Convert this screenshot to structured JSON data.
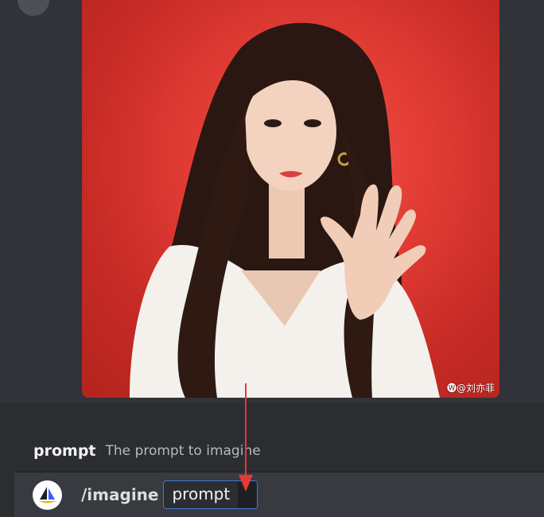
{
  "attachment": {
    "watermark": "🅦@刘亦菲"
  },
  "autocomplete": {
    "option_name": "prompt",
    "option_description": "The prompt to imagine"
  },
  "composer": {
    "command": "/imagine",
    "param_label": "prompt"
  },
  "colors": {
    "background": "#313338",
    "composer_band": "#2b2d31",
    "input_row": "#383a40",
    "chip_border": "#3b7ce0",
    "annotation_arrow": "#e53935"
  },
  "icons": {
    "bot_avatar": "midjourney-sailboat-icon",
    "annotation": "red-arrow-down-icon"
  }
}
